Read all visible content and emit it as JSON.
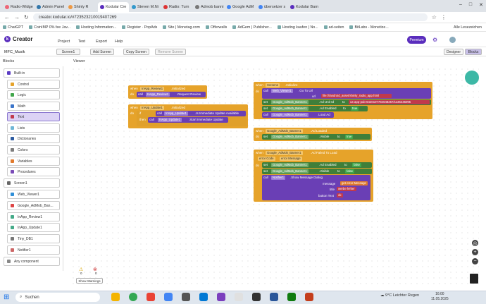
{
  "browser": {
    "tabs": [
      "Radio-Widge",
      "Admin Panel",
      "Shinly R",
      "Kodular Cre",
      "Steven M.Ni",
      "Radio: Turn",
      "Admob banni",
      "Google AdM",
      "übersetzer s",
      "Kodular Barn"
    ],
    "active_tab": 3,
    "url": "creator.kodular.io/#723523210019407269",
    "bookmarks": [
      "ChatGPT",
      "CoinIMP 0% fee Jav...",
      "Hosting Information...",
      "Register · PopAds",
      "Site | Monetag.com",
      "Offerwalls",
      "AdGem | Publisher...",
      "Hosting kaufen | No...",
      "ad-seiten",
      "BitLabs - Monetize..."
    ],
    "all_bookmarks": "Alle Lesezeichen"
  },
  "app": {
    "name": "Creator",
    "menu": [
      "Project",
      "Test",
      "Export",
      "Help"
    ],
    "premium": "Premium",
    "project_name": "MFC_Musik",
    "screen": "Screen1",
    "add_screen": "Add Screen",
    "copy_screen": "Copy Screen",
    "remove_screen": "Remove Screen",
    "designer": "Designer",
    "blocks": "Blocks",
    "blocks_label": "Blocks",
    "viewer_label": "Viewer",
    "show_warnings": "Show Warnings",
    "warn_count": "0",
    "error_count": "0"
  },
  "palette": [
    {
      "label": "Built-in",
      "color": "#5b3cc4"
    },
    {
      "label": "Control",
      "color": "#e6a32a"
    },
    {
      "label": "Logic",
      "color": "#41a64b"
    },
    {
      "label": "Math",
      "color": "#3a74c9"
    },
    {
      "label": "Text",
      "color": "#c0394d"
    },
    {
      "label": "Lists",
      "color": "#6eb6d6"
    },
    {
      "label": "Dictionaries",
      "color": "#2c5aa0"
    },
    {
      "label": "Colors",
      "color": "#7d7d7d"
    },
    {
      "label": "Variables",
      "color": "#e17a2c"
    },
    {
      "label": "Procedures",
      "color": "#7a4ab7"
    },
    {
      "label": "Screen1",
      "color": "#666666"
    },
    {
      "label": "Web_Viewer1",
      "color": "#2f8fd8"
    },
    {
      "label": "Google_AdMob_Ban...",
      "color": "#d44"
    },
    {
      "label": "InApp_Review1",
      "color": "#4a8"
    },
    {
      "label": "InApp_Update1",
      "color": "#4a8"
    },
    {
      "label": "Tiny_DB1",
      "color": "#777"
    },
    {
      "label": "Notifier1",
      "color": "#c66"
    },
    {
      "label": "Any component",
      "color": "#888"
    }
  ],
  "blocks": {
    "review_when": "when",
    "review_comp": "InApp_Review1",
    "review_event": ".Initialized",
    "review_do": "do",
    "review_call": "call",
    "review_call_comp": "InApp_Review1",
    "review_method": ".Request Review",
    "update_when": "when",
    "update_comp": "InApp_Update1",
    "update_event": ".Initialized",
    "update_do": "do",
    "update_if": "if",
    "update_then": "then",
    "update_call1": "call",
    "update_call1_comp": "InApp_Update1",
    "update_method1": ".Is Immediate Update Available",
    "update_call2": "call",
    "update_call2_comp": "InApp_Update1",
    "update_method2": ".Start Immediate Update",
    "screen_when": "when",
    "screen_comp": "Screen1",
    "screen_event": ".Initialize",
    "screen_do": "do",
    "s_call": "call",
    "s_web": "Web_Viewer1",
    "s_goto": ".Go To Url",
    "s_url_lbl": "url",
    "s_url": "file:///android_asset/shinly_radio_app.html",
    "s_set1": "set",
    "s_b1": "Google_AdMob_Banner1",
    "s_p1": ".Ad Unit Id",
    "s_to1": "to",
    "s_adunit": "ca-app-pub-6420107784648257/1135445095",
    "s_set2": "set",
    "s_b2": "Google_AdMob_Banner1",
    "s_p2": ".Ad Enabled",
    "s_to2": "to",
    "s_true2": "true",
    "s_call3": "call",
    "s_b3": "Google_AdMob_Banner1",
    "s_p3": ".Load Ad",
    "loaded_when": "when",
    "loaded_comp": "Google_AdMob_Banner1",
    "loaded_event": ".Ad Loaded",
    "loaded_do": "do",
    "loaded_set": "set",
    "loaded_b": "Google_AdMob_Banner1",
    "loaded_p": ".Visible",
    "loaded_to": "to",
    "loaded_true": "true",
    "fail_when": "when",
    "fail_comp": "Google_AdMob_Banner1",
    "fail_event": ".Ad Failed To Load",
    "fail_p1": "error Code",
    "fail_p2": "error Message",
    "fail_do": "do",
    "f_set1": "set",
    "f_b1": "Google_AdMob_Banner1",
    "f_p1": ".Ad Enabled",
    "f_to1": "to",
    "f_false1": "false",
    "f_set2": "set",
    "f_b2": "Google_AdMob_Banner1",
    "f_p2": ".Visible",
    "f_to2": "to",
    "f_false2": "false",
    "f_call": "call",
    "f_notifier": "Notifier1",
    "f_method": ".Show Message Dialog",
    "f_msg_lbl": "message",
    "f_get": "get",
    "f_get_var": "error Message",
    "f_title_lbl": "title",
    "f_title": "werbe fehler",
    "f_btn_lbl": "button Text",
    "f_btn": "ok"
  },
  "taskbar": {
    "search": "Suchen",
    "weather": "9°C  Leichter Regen",
    "time": "16:00",
    "date": "11.05.2025"
  }
}
